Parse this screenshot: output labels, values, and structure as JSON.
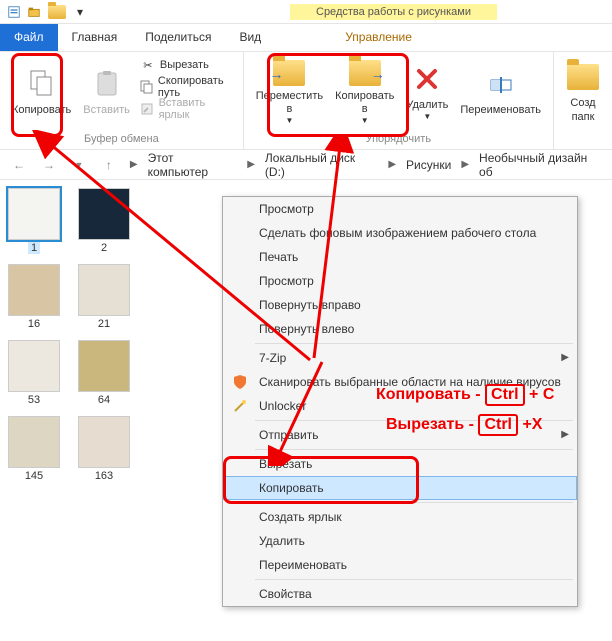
{
  "titlebar": {
    "tool_context": "Средства работы с рисунками"
  },
  "tabs": {
    "file": "Файл",
    "main": "Главная",
    "share": "Поделиться",
    "view": "Вид",
    "manage": "Управление"
  },
  "ribbon": {
    "clipboard": {
      "copy": "Копировать",
      "paste": "Вставить",
      "cut": "Вырезать",
      "copy_path": "Скопировать путь",
      "paste_shortcut": "Вставить ярлык",
      "group_label": "Буфер обмена"
    },
    "organize": {
      "move_to": "Переместить в",
      "copy_to": "Копировать в",
      "delete": "Удалить",
      "rename": "Переименовать",
      "group_label": "Упорядочить"
    },
    "new": {
      "new_folder_line1": "Созд",
      "new_folder_line2": "папк"
    }
  },
  "breadcrumb": {
    "seg1": "Этот компьютер",
    "seg2": "Локальный диск (D:)",
    "seg3": "Рисунки",
    "seg4": "Необычный дизайн об"
  },
  "thumbs": [
    {
      "label": "1",
      "selected": true,
      "bg": "#f4f4f0"
    },
    {
      "label": "2",
      "selected": false,
      "bg": "#17283a"
    },
    {
      "label": "16",
      "selected": false,
      "bg": "#d8c5a4"
    },
    {
      "label": "21",
      "selected": false,
      "bg": "#e6e0d4"
    },
    {
      "label": "53",
      "selected": false,
      "bg": "#ece8e0"
    },
    {
      "label": "64",
      "selected": false,
      "bg": "#c9b77e"
    },
    {
      "label": "145",
      "selected": false,
      "bg": "#dcd6c2"
    },
    {
      "label": "163",
      "selected": false,
      "bg": "#e6ddd0"
    }
  ],
  "context_menu": {
    "preview": "Просмотр",
    "set_wallpaper": "Сделать фоновым изображением рабочего стола",
    "print": "Печать",
    "preview2": "Просмотр",
    "rotate_right": "Повернуть вправо",
    "rotate_left": "Повернуть влево",
    "sevenzip": "7-Zip",
    "scan": "Сканировать выбранные области на наличие вирусов",
    "unlocker": "Unlocker",
    "send_to": "Отправить",
    "cut": "Вырезать",
    "copy": "Копировать",
    "create_shortcut": "Создать ярлык",
    "delete": "Удалить",
    "rename": "Переименовать",
    "properties": "Свойства"
  },
  "annotations": {
    "copy_label": "Копировать -",
    "cut_label": "Вырезать -",
    "ctrl": "Ctrl",
    "plus_c": "+ C",
    "plus_x": "+X"
  }
}
